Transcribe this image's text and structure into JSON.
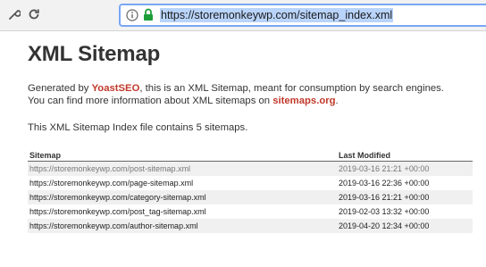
{
  "browser": {
    "url": "https://storemonkeywp.com/sitemap_index.xml"
  },
  "page": {
    "title": "XML Sitemap",
    "line1": {
      "before": "Generated by ",
      "link": "YoastSEO",
      "after": ", this is an XML Sitemap, meant for consumption by search engines."
    },
    "line2": {
      "before": "You can find more information about XML sitemaps on ",
      "link": "sitemaps.org",
      "after": "."
    },
    "count_text": "This XML Sitemap Index file contains 5 sitemaps.",
    "table": {
      "headers": {
        "sitemap": "Sitemap",
        "last_modified": "Last Modified"
      },
      "rows": [
        {
          "sitemap": "https://storemonkeywp.com/post-sitemap.xml",
          "last_modified": "2019-03-16 21:21 +00:00"
        },
        {
          "sitemap": "https://storemonkeywp.com/page-sitemap.xml",
          "last_modified": "2019-03-16 22:36 +00:00"
        },
        {
          "sitemap": "https://storemonkeywp.com/category-sitemap.xml",
          "last_modified": "2019-03-16 21:21 +00:00"
        },
        {
          "sitemap": "https://storemonkeywp.com/post_tag-sitemap.xml",
          "last_modified": "2019-02-03 13:32 +00:00"
        },
        {
          "sitemap": "https://storemonkeywp.com/author-sitemap.xml",
          "last_modified": "2019-04-20 12:34 +00:00"
        }
      ]
    }
  },
  "icons": {
    "settings": "wrench-icon",
    "reload": "reload-icon",
    "info": "info-icon",
    "lock": "lock-icon"
  },
  "colors": {
    "link_red": "#c0392b",
    "lock_green": "#1e9e3a",
    "url_highlight": "#b9d4fb"
  }
}
